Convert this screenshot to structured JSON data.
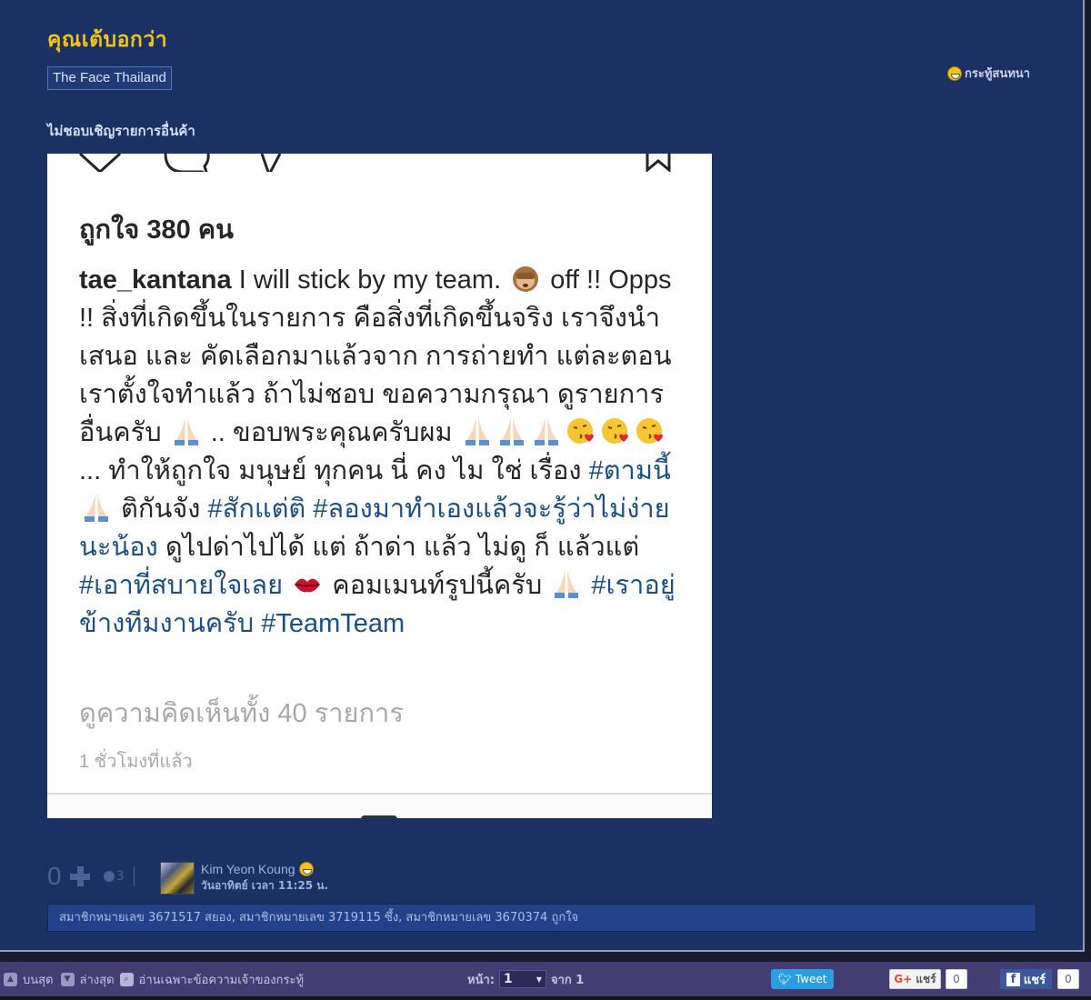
{
  "topic": {
    "title": "คุณเต้บอกว่า",
    "tag": "The Face Thailand",
    "type_label": "กระทู้สนทนา",
    "body": "ไม่ชอบเชิญรายการอื่นค้า"
  },
  "instagram_post": {
    "likes": "ถูกใจ 380 คน",
    "username": "tae_kantana",
    "caption_segments": [
      {
        "kind": "text",
        "value": " I will stick by my team. "
      },
      {
        "kind": "emoji",
        "value": "see-no-evil-monkey"
      },
      {
        "kind": "text",
        "value": " off !! Opps !! สิ่งที่เกิดขึ้นในรายการ คือสิ่งที่เกิดขึ้นจริง เราจึงนำเสนอ และ คัดเลือกมาแล้วจาก การถ่ายทำ แต่ละตอน  เราตั้งใจทำแล้ว ถ้าไม่ชอบ ขอความกรุณา ดูรายการอื่นครับ "
      },
      {
        "kind": "emoji",
        "value": "folded-hands"
      },
      {
        "kind": "text",
        "value": " .. ขอบพระคุณครับผม "
      },
      {
        "kind": "emoji",
        "value": "folded-hands"
      },
      {
        "kind": "emoji",
        "value": "folded-hands"
      },
      {
        "kind": "emoji",
        "value": "folded-hands"
      },
      {
        "kind": "emoji",
        "value": "kissing-face"
      },
      {
        "kind": "emoji",
        "value": "kissing-face"
      },
      {
        "kind": "emoji",
        "value": "kissing-face"
      },
      {
        "kind": "text",
        "value": " ... ทำให้ถูกใจ มนุษย์ ทุกคน นี่ คง ไม ใช่ เรื่อง "
      },
      {
        "kind": "hashtag",
        "value": "#ตามนี้"
      },
      {
        "kind": "text",
        "value": " "
      },
      {
        "kind": "emoji",
        "value": "folded-hands"
      },
      {
        "kind": "text",
        "value": " ติกันจัง "
      },
      {
        "kind": "hashtag",
        "value": "#สักแต่ติ"
      },
      {
        "kind": "text",
        "value": " "
      },
      {
        "kind": "hashtag",
        "value": "#ลองมาทำเองแล้วจะรู้ว่าไม่ง่ายนะน้อง"
      },
      {
        "kind": "text",
        "value": " ดูไปด่าไปได้ แต่ ถ้าด่า แล้ว ไม่ดู ก็ แล้วแต่ "
      },
      {
        "kind": "hashtag",
        "value": "#เอาที่สบายใจเลย"
      },
      {
        "kind": "text",
        "value": " "
      },
      {
        "kind": "emoji",
        "value": "kiss-mark"
      },
      {
        "kind": "text",
        "value": "  คอมเมนท์รูปนี้ครับ "
      },
      {
        "kind": "emoji",
        "value": "folded-hands"
      },
      {
        "kind": "text",
        "value": " "
      },
      {
        "kind": "hashtag",
        "value": "#เราอยู่ข้างทีมงานครับ"
      },
      {
        "kind": "text",
        "value": " "
      },
      {
        "kind": "hashtag",
        "value": "#TeamTeam"
      }
    ],
    "view_comments": "ดูความคิดเห็นทั้ง 40 รายการ",
    "time_ago": "1 ชั่วโมงที่แล้ว"
  },
  "post_meta": {
    "vote_count": "0",
    "emotion_count": "3",
    "author_name": "Kim Yeon Koung",
    "post_time": "วันอาทิตย์ เวลา 11:25 น.",
    "likes_text": "สมาชิกหมายเลข 3671517 สยอง, สมาชิกหมายเลข 3719115 ซึ้ง, สมาชิกหมายเลข 3670374 ถูกใจ"
  },
  "bottom_bar": {
    "top_label": "บนสุด",
    "bottom_label": "ล่างสุด",
    "owner_only_label": "อ่านเฉพาะข้อความเจ้าของกระทู้",
    "page_label": "หน้า:",
    "page_value": "1",
    "page_total": "จาก 1",
    "tweet_label": "Tweet",
    "gplus_label": "แชร์",
    "gplus_count": "0",
    "fb_label": "แชร์",
    "fb_count": "0"
  },
  "colors": {
    "panel_bg": "#1c3163",
    "title": "#f2c31b",
    "hashtag": "#1d4f80",
    "tweet": "#2a9ee0",
    "facebook": "#3b5998"
  }
}
